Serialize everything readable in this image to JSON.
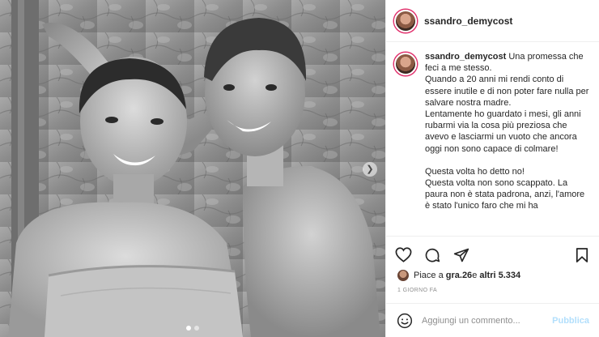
{
  "post": {
    "username": "ssandro_demycost",
    "caption_username": "ssandro_demycost",
    "caption_lines": [
      "Una promessa che feci a me stesso.",
      "Quando a 20 anni mi rendi conto di essere inutile e di non poter fare nulla per salvare nostra madre.",
      "Lentamente ho guardato i mesi, gli anni rubarmi via la cosa più preziosa che avevo e lasciarmi un vuoto che ancora oggi non sono capace di colmare!",
      "",
      "Questa volta ho detto no!",
      "Questa volta non sono scappato. La paura non è stata padrona, anzi, l'amore è stato l'unico faro che mi ha"
    ],
    "likes": {
      "prefix": "Piace a ",
      "user": "gra.26",
      "middle": " e ",
      "others": "altri 5.334"
    },
    "timestamp": "1 giorno fa"
  },
  "icons": {
    "like": "heart-icon",
    "comment": "comment-icon",
    "share": "share-icon",
    "save": "bookmark-icon",
    "emoji": "emoji-icon",
    "next": "chevron-right-icon"
  },
  "comment": {
    "placeholder": "Aggiungi un commento...",
    "publish_label": "Pubblica"
  },
  "colors": {
    "story_ring": "#e1306c",
    "publish_disabled": "#b2dffc",
    "muted_text": "#8e8e8e"
  }
}
